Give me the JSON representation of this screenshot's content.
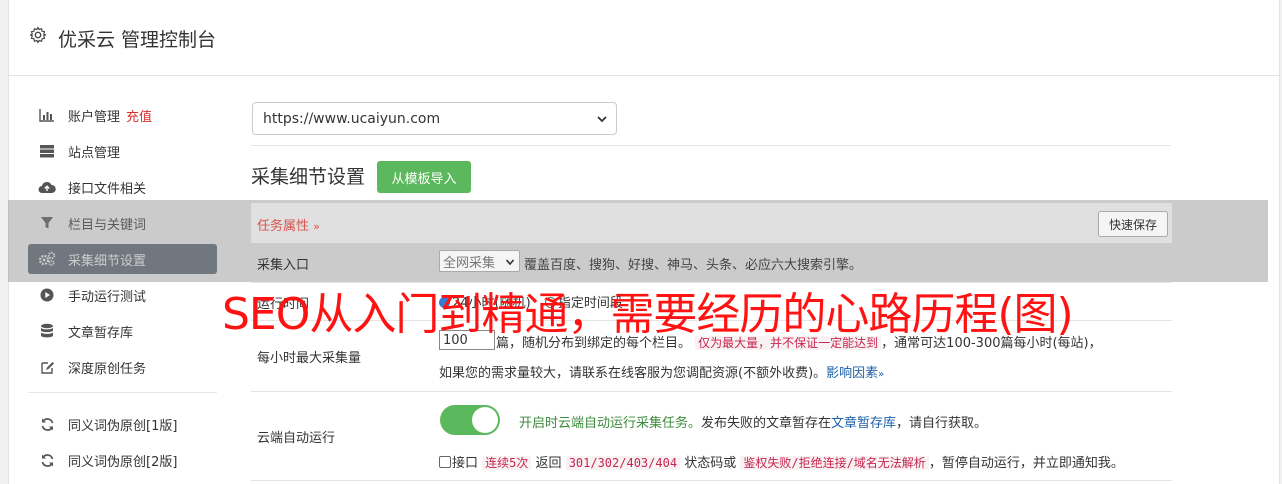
{
  "header": {
    "title": "优采云 管理控制台",
    "icon": "gear-icon"
  },
  "sidebar": {
    "items": [
      {
        "label": "账户管理",
        "badge": "充值",
        "icon": "bar-chart-icon"
      },
      {
        "label": "站点管理",
        "icon": "server-icon"
      },
      {
        "label": "接口文件相关",
        "icon": "cloud-upload-icon"
      },
      {
        "label": "栏目与关键词",
        "icon": "filter-icon"
      },
      {
        "label": "采集细节设置",
        "icon": "gears-icon",
        "active": true
      },
      {
        "label": "手动运行测试",
        "icon": "play-circle-icon"
      },
      {
        "label": "文章暂存库",
        "icon": "database-icon"
      },
      {
        "label": "深度原创任务",
        "icon": "edit-icon"
      },
      {
        "label": "同义词伪原创[1版]",
        "icon": "refresh-icon"
      },
      {
        "label": "同义词伪原创[2版]",
        "icon": "refresh-icon"
      }
    ]
  },
  "main": {
    "site_select": "https://www.ucaiyun.com",
    "section_title": "采集细节设置",
    "template_button": "从模板导入",
    "task_attr": "任务属性",
    "quick_save": "快速保存",
    "collect_entry": {
      "label": "采集入口",
      "select": "全网采集",
      "desc": "覆盖百度、搜狗、好搜、神马、头条、必应六大搜索引擎。"
    },
    "run_time": {
      "label": "运行时间",
      "option_a": "24小时(随机)",
      "option_b": "指定时间段"
    },
    "max_count": {
      "label": "每小时最大采集量",
      "value": "100",
      "text1": "篇，随机分布到绑定的每个栏目。",
      "note": "仅为最大量，并不保证一定能达到",
      "text2": "，通常可达100-300篇每小时(每站)，",
      "text3": "如果您的需求量较大，请联系在线客服为您调配资源(不额外收费)。",
      "link": "影响因素"
    },
    "cloud_run": {
      "label": "云端自动运行",
      "enabled_text": "开启时云端自动运行采集任务。",
      "text1": "发布失败的文章暂存在",
      "link": "文章暂存库",
      "text2": "，请自行获取。",
      "check_label": "接口",
      "code1": "连续5次",
      "text3": "返回",
      "code2": "301/302/403/404",
      "text4": "状态码或",
      "code3": "鉴权失败/拒绝连接/域名无法解析",
      "text5": "，暂停自动运行，并立即通知我。"
    }
  },
  "overlay_text": "SEO从入门到精通，需要经历的心路历程(图)",
  "colors": {
    "active_nav": "#5b6676",
    "green": "#5cb85c",
    "red": "#d9302c",
    "overlay": "#ff1212"
  }
}
